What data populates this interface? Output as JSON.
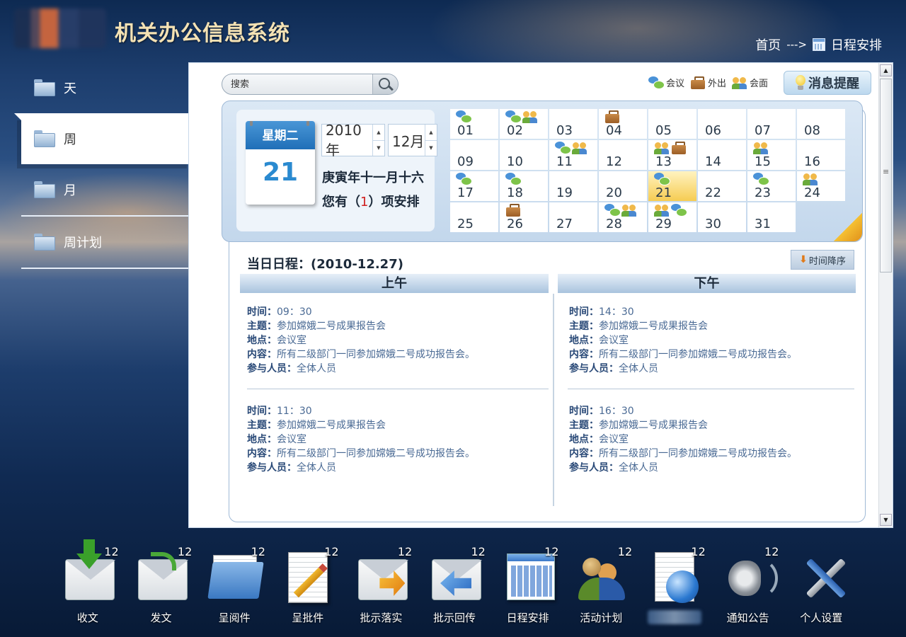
{
  "header": {
    "title": "机关办公信息系统",
    "breadcrumb": {
      "home": "首页",
      "separator": "--->",
      "current": "日程安排"
    }
  },
  "sidebar": {
    "items": [
      {
        "label": "天",
        "active": false
      },
      {
        "label": "周",
        "active": true
      },
      {
        "label": "月",
        "active": false
      },
      {
        "label": "周计划",
        "active": false
      }
    ]
  },
  "search": {
    "placeholder": "搜索"
  },
  "legend": {
    "meeting": "会议",
    "out": "外出",
    "meet_face": "会面"
  },
  "remind_label": "消息提醒",
  "date_panel": {
    "weekday": "星期二",
    "day": "21",
    "year": "2010年",
    "month": "12月",
    "lunar": "庚寅年十一月十六",
    "arrangement_prefix": "您有（",
    "arrangement_count": "1",
    "arrangement_suffix": "）项安排"
  },
  "calendar": {
    "days": [
      {
        "d": "01",
        "icons": [
          "meeting"
        ]
      },
      {
        "d": "02",
        "icons": [
          "meeting",
          "meet"
        ]
      },
      {
        "d": "03",
        "icons": []
      },
      {
        "d": "04",
        "icons": [
          "out"
        ]
      },
      {
        "d": "05",
        "icons": []
      },
      {
        "d": "06",
        "icons": []
      },
      {
        "d": "07",
        "icons": []
      },
      {
        "d": "08",
        "icons": []
      },
      {
        "d": "09",
        "icons": []
      },
      {
        "d": "10",
        "icons": []
      },
      {
        "d": "11",
        "icons": [
          "meeting",
          "meet"
        ]
      },
      {
        "d": "12",
        "icons": []
      },
      {
        "d": "13",
        "icons": [
          "meet",
          "out"
        ]
      },
      {
        "d": "14",
        "icons": []
      },
      {
        "d": "15",
        "icons": [
          "meet"
        ]
      },
      {
        "d": "16",
        "icons": []
      },
      {
        "d": "17",
        "icons": [
          "meeting"
        ]
      },
      {
        "d": "18",
        "icons": [
          "meeting"
        ]
      },
      {
        "d": "19",
        "icons": []
      },
      {
        "d": "20",
        "icons": []
      },
      {
        "d": "21",
        "icons": [
          "meeting"
        ],
        "today": true
      },
      {
        "d": "22",
        "icons": []
      },
      {
        "d": "23",
        "icons": [
          "meeting"
        ]
      },
      {
        "d": "24",
        "icons": [
          "meet"
        ]
      },
      {
        "d": "25",
        "icons": []
      },
      {
        "d": "26",
        "icons": [
          "out"
        ]
      },
      {
        "d": "27",
        "icons": []
      },
      {
        "d": "28",
        "icons": [
          "meeting",
          "meet"
        ]
      },
      {
        "d": "29",
        "icons": [
          "meet",
          "meeting"
        ]
      },
      {
        "d": "30",
        "icons": []
      },
      {
        "d": "31",
        "icons": []
      }
    ]
  },
  "schedule": {
    "title": "当日日程：(2010-12.27)",
    "sort_label": "时间降序",
    "am_label": "上午",
    "pm_label": "下午",
    "field_labels": {
      "time": "时间：",
      "subject": "主题：",
      "place": "地点：",
      "content": "内容：",
      "people": "参与人员："
    },
    "am": [
      {
        "time": "09：30",
        "subject": "参加嫦娥二号成果报告会",
        "place": "会议室",
        "content": "所有二级部门一同参加嫦娥二号成功报告会。",
        "people": "全体人员"
      },
      {
        "time": "11：30",
        "subject": "参加嫦娥二号成果报告会",
        "place": "会议室",
        "content": "所有二级部门一同参加嫦娥二号成功报告会。",
        "people": "全体人员"
      }
    ],
    "pm": [
      {
        "time": "14：30",
        "subject": "参加嫦娥二号成果报告会",
        "place": "会议室",
        "content": "所有二级部门一同参加嫦娥二号成功报告会。",
        "people": "全体人员"
      },
      {
        "time": "16：30",
        "subject": "参加嫦娥二号成果报告会",
        "place": "会议室",
        "content": "所有二级部门一同参加嫦娥二号成功报告会。",
        "people": "全体人员"
      }
    ]
  },
  "dock": [
    {
      "label": "收文",
      "badge": "12",
      "icon": "inbox-icon"
    },
    {
      "label": "发文",
      "badge": "12",
      "icon": "send-icon"
    },
    {
      "label": "呈阅件",
      "badge": "12",
      "icon": "folder-icon"
    },
    {
      "label": "呈批件",
      "badge": "12",
      "icon": "document-pencil-icon"
    },
    {
      "label": "批示落实",
      "badge": "12",
      "icon": "mail-forward-icon"
    },
    {
      "label": "批示回传",
      "badge": "12",
      "icon": "mail-reply-icon"
    },
    {
      "label": "日程安排",
      "badge": "12",
      "icon": "calendar-icon"
    },
    {
      "label": "活动计划",
      "badge": "12",
      "icon": "people-icon"
    },
    {
      "label": "",
      "badge": "12",
      "icon": "globe-document-icon"
    },
    {
      "label": "通知公告",
      "badge": "12",
      "icon": "speaker-icon"
    },
    {
      "label": "个人设置",
      "badge": "",
      "icon": "tools-icon"
    }
  ]
}
